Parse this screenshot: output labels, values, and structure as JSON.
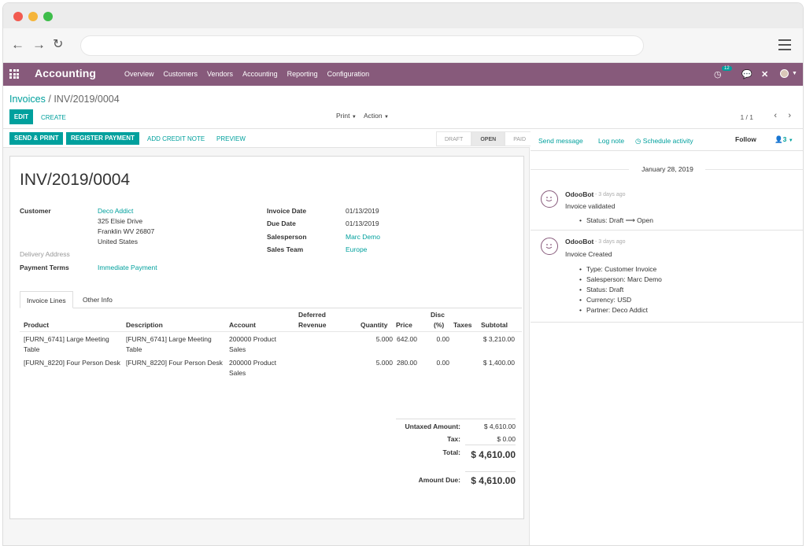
{
  "app": {
    "title": "Accounting",
    "menu": [
      "Overview",
      "Customers",
      "Vendors",
      "Accounting",
      "Reporting",
      "Configuration"
    ],
    "activity_badge": "12",
    "colors": {
      "brand": "#875a7b",
      "accent": "#00a09d"
    }
  },
  "breadcrumb": {
    "parent": "Invoices",
    "separator": "/",
    "current": "INV/2019/0004"
  },
  "control": {
    "edit": "EDIT",
    "create": "CREATE",
    "print": "Print",
    "action": "Action",
    "pager": "1 / 1"
  },
  "statusbar": {
    "send_print": "SEND & PRINT",
    "register_payment": "REGISTER PAYMENT",
    "add_credit_note": "ADD CREDIT NOTE",
    "preview": "PREVIEW",
    "stages": [
      "DRAFT",
      "OPEN",
      "PAID"
    ],
    "active_stage": "OPEN"
  },
  "invoice": {
    "name": "INV/2019/0004",
    "customer_label": "Customer",
    "customer_name": "Deco Addict",
    "address": [
      "325 Elsie Drive",
      "Franklin WV 26807",
      "United States"
    ],
    "delivery_label": "Delivery Address",
    "payment_terms_label": "Payment Terms",
    "payment_terms": "Immediate Payment",
    "invoice_date_label": "Invoice Date",
    "invoice_date": "01/13/2019",
    "due_date_label": "Due Date",
    "due_date": "01/13/2019",
    "salesperson_label": "Salesperson",
    "salesperson": "Marc Demo",
    "sales_team_label": "Sales Team",
    "sales_team": "Europe"
  },
  "tabs": [
    "Invoice Lines",
    "Other Info"
  ],
  "lines": {
    "headers": {
      "product": "Product",
      "description": "Description",
      "account": "Account",
      "deferred_1": "Deferred",
      "deferred_2": "Revenue",
      "quantity": "Quantity",
      "price": "Price",
      "disc_1": "Disc",
      "disc_2": "(%)",
      "taxes": "Taxes",
      "subtotal": "Subtotal"
    },
    "rows": [
      {
        "product_1": "[FURN_6741] Large Meeting",
        "product_2": "Table",
        "description_1": "[FURN_6741] Large Meeting",
        "description_2": "Table",
        "account_1": "200000 Product",
        "account_2": "Sales",
        "quantity": "5.000",
        "price": "642.00",
        "discount": "0.00",
        "subtotal": "$ 3,210.00"
      },
      {
        "product_1": "[FURN_8220] Four Person Desk",
        "product_2": "",
        "description_1": "[FURN_8220] Four Person Desk",
        "description_2": "",
        "account_1": "200000 Product",
        "account_2": "Sales",
        "quantity": "5.000",
        "price": "280.00",
        "discount": "0.00",
        "subtotal": "$ 1,400.00"
      }
    ]
  },
  "totals": {
    "untaxed_label": "Untaxed Amount:",
    "untaxed": "$ 4,610.00",
    "tax_label": "Tax:",
    "tax": "$ 0.00",
    "total_label": "Total:",
    "total": "$ 4,610.00",
    "amount_due_label": "Amount Due:",
    "amount_due": "$ 4,610.00"
  },
  "chatter": {
    "send_message": "Send message",
    "log_note": "Log note",
    "schedule_activity": "Schedule activity",
    "follow": "Follow",
    "followers": "3",
    "date": "January 28, 2019",
    "messages": [
      {
        "author": "OdooBot",
        "time": "- 3 days ago",
        "body": "Invoice validated",
        "items": [
          "Status: Draft ⟶ Open"
        ]
      },
      {
        "author": "OdooBot",
        "time": "- 3 days ago",
        "body": "Invoice Created",
        "items": [
          "Type: Customer Invoice",
          "Salesperson: Marc Demo",
          "Status: Draft",
          "Currency: USD",
          "Partner: Deco Addict"
        ]
      }
    ]
  }
}
